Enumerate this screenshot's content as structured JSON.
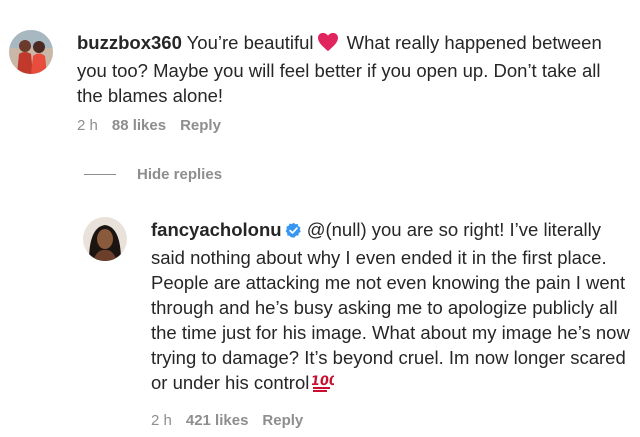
{
  "comments": [
    {
      "username": "buzzbox360",
      "text_before_emoji": " You’re beautiful",
      "emoji": "red-heart",
      "text_after_emoji": " What really happened between you too? Maybe you will feel better if you open up. Don’t take all the blames alone!",
      "time": "2 h",
      "likes": "88 likes",
      "reply_label": "Reply"
    }
  ],
  "replies_toggle": {
    "label": "Hide replies"
  },
  "replies": [
    {
      "username": "fancyacholonu",
      "verified": true,
      "text": " @(null) you are so right! I’ve literally said nothing about why I even ended it in the first place. People are attacking me not even knowing the pain I went through and he’s busy asking me to apologize publicly all the time just for his image. What about my image he’s now trying to damage? It’s beyond cruel. Im now longer scared or under his control",
      "emoji": "hundred-points",
      "time": "2 h",
      "likes": "421 likes",
      "reply_label": "Reply"
    }
  ],
  "colors": {
    "text": "#262626",
    "muted": "#8e8e8e",
    "verified_blue": "#3797f0",
    "heart_red": "#e0245e"
  }
}
